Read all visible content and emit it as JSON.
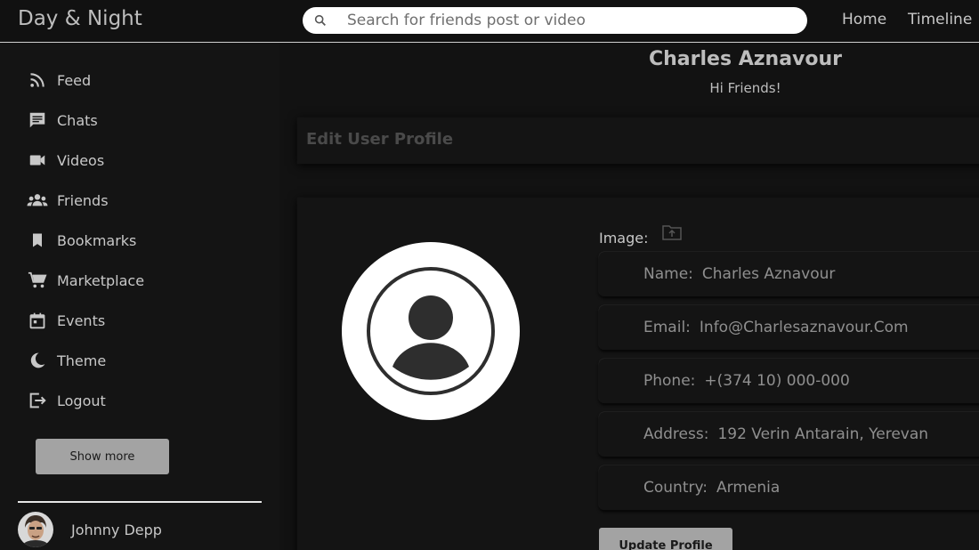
{
  "app": {
    "title": "Day & Night"
  },
  "search": {
    "placeholder": "Search for friends post or video"
  },
  "topnav": {
    "home": "Home",
    "timeline": "Timeline"
  },
  "sidebar": {
    "items": [
      {
        "label": "Feed",
        "icon": "rss-feed-icon"
      },
      {
        "label": "Chats",
        "icon": "chat-icon"
      },
      {
        "label": "Videos",
        "icon": "video-camera-icon"
      },
      {
        "label": "Friends",
        "icon": "group-icon"
      },
      {
        "label": "Bookmarks",
        "icon": "bookmark-icon"
      },
      {
        "label": "Marketplace",
        "icon": "shopping-cart-icon"
      },
      {
        "label": "Events",
        "icon": "calendar-icon"
      },
      {
        "label": "Theme",
        "icon": "moon-icon"
      },
      {
        "label": "Logout",
        "icon": "logout-icon"
      }
    ],
    "show_more": "Show more",
    "friend": {
      "name": "Johnny Depp"
    }
  },
  "profile": {
    "name": "Charles Aznavour",
    "subtitle": "Hi Friends!",
    "edit_title": "Edit User Profile",
    "image_label": "Image:",
    "fields": [
      {
        "key": "Name:",
        "value": "Charles Aznavour"
      },
      {
        "key": "Email:",
        "value": "Info@Charlesaznavour.Com"
      },
      {
        "key": "Phone:",
        "value": "+(374 10) 000-000"
      },
      {
        "key": "Address:",
        "value": "192 Verin Antarain, Yerevan"
      },
      {
        "key": "Country:",
        "value": "Armenia"
      }
    ],
    "update_label": "Update Profile"
  },
  "colors": {
    "background": "#121212",
    "button": "#a3a3a3",
    "text": "#c8c8c8"
  }
}
